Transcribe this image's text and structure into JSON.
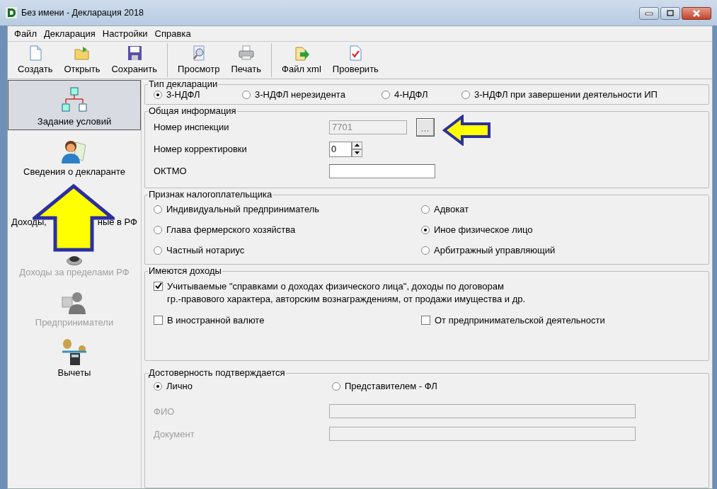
{
  "window": {
    "title": "Без имени - Декларация 2018"
  },
  "menu": [
    "Файл",
    "Декларация",
    "Настройки",
    "Справка"
  ],
  "toolbar": [
    [
      {
        "label": "Создать",
        "kind": "new"
      },
      {
        "label": "Открыть",
        "kind": "open"
      },
      {
        "label": "Сохранить",
        "kind": "save"
      }
    ],
    [
      {
        "label": "Просмотр",
        "kind": "preview"
      },
      {
        "label": "Печать",
        "kind": "print"
      }
    ],
    [
      {
        "label": "Файл xml",
        "kind": "xml"
      },
      {
        "label": "Проверить",
        "kind": "check"
      }
    ]
  ],
  "sidebar": {
    "items": [
      {
        "kind": "conditions",
        "label": "Задание условий",
        "selected": true,
        "disabled": false
      },
      {
        "kind": "person",
        "label": "Сведения о декларанте",
        "selected": false,
        "disabled": false
      },
      {
        "kind": "covered",
        "label_parts": [
          "Доходы,",
          "ные в РФ"
        ],
        "selected": false,
        "disabled": false
      },
      {
        "kind": "abroad",
        "label": "Доходы за пределами РФ",
        "selected": false,
        "disabled": true
      },
      {
        "kind": "business",
        "label": "Предприниматели",
        "selected": false,
        "disabled": true
      },
      {
        "kind": "deductions",
        "label": "Вычеты",
        "selected": false,
        "disabled": false
      }
    ]
  },
  "declaration_type": {
    "title": "Тип декларации",
    "options": [
      {
        "label": "3-НДФЛ",
        "selected": true
      },
      {
        "label": "3-НДФЛ нерезидента",
        "selected": false
      },
      {
        "label": "4-НДФЛ",
        "selected": false
      },
      {
        "label": "3-НДФЛ при завершении деятельности ИП",
        "selected": false
      }
    ]
  },
  "general_info": {
    "title": "Общая информация",
    "inspection": {
      "label": "Номер инспекции",
      "value": "7701",
      "disabled": true
    },
    "correction": {
      "label": "Номер корректировки",
      "value": "0"
    },
    "oktmo": {
      "label": "ОКТМО"
    }
  },
  "taxpayer": {
    "title": "Признак налогоплательщика",
    "options": [
      {
        "label": "Индивидуальный предприниматель",
        "selected": false
      },
      {
        "label": "Адвокат",
        "selected": false
      },
      {
        "label": "Глава фермерского хозяйства",
        "selected": false
      },
      {
        "label": "Иное физическое лицо",
        "selected": true
      },
      {
        "label": "Частный нотариус",
        "selected": false
      },
      {
        "label": "Арбитражный управляющий",
        "selected": false
      }
    ]
  },
  "income": {
    "title": "Имеются доходы",
    "items": [
      {
        "label": "Учитываемые \"справками о доходах физического лица\", доходы по договорам\nгр.-правового характера, авторским вознаграждениям, от продажи имущества и др.",
        "checked": true
      },
      {
        "label": "В иностранной валюте",
        "checked": false
      },
      {
        "label": "От предпринимательской деятельности",
        "checked": false
      }
    ]
  },
  "confirmation": {
    "title": "Достоверность подтверждается",
    "options": [
      {
        "label": "Лично",
        "selected": true
      },
      {
        "label": "Представителем - ФЛ",
        "selected": false
      }
    ],
    "fields": [
      {
        "label": "ФИО",
        "disabled": true
      },
      {
        "label": "Документ",
        "disabled": true
      }
    ]
  },
  "annotations": [
    {
      "kind": "arrow-left"
    },
    {
      "kind": "arrow-up"
    }
  ]
}
